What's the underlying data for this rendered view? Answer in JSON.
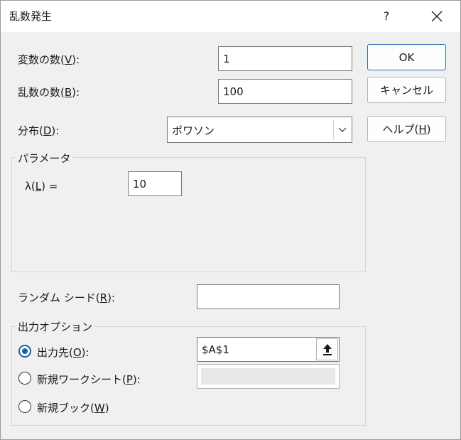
{
  "window": {
    "title": "乱数発生",
    "help_glyph": "?"
  },
  "fields": {
    "num_variables": {
      "label": "変数の数(",
      "key": "V",
      "suffix": "):",
      "value": "1"
    },
    "num_random": {
      "label": "乱数の数(",
      "key": "B",
      "suffix": "):",
      "value": "100"
    },
    "distribution": {
      "label": "分布(",
      "key": "D",
      "suffix": "):",
      "value": "ポワソン"
    },
    "seed": {
      "label": "ランダム シード(",
      "key": "R",
      "suffix": "):",
      "value": ""
    }
  },
  "buttons": {
    "ok": "OK",
    "cancel": "キャンセル",
    "help_prefix": "ヘルプ(",
    "help_key": "H",
    "help_suffix": ")"
  },
  "parameters": {
    "title": "パラメータ",
    "lambda_label": "λ(",
    "lambda_key": "L",
    "lambda_suffix": ")  =",
    "lambda_value": "10"
  },
  "output": {
    "title": "出力オプション",
    "output_range": {
      "label": "出力先(",
      "key": "O",
      "suffix": "):",
      "value": "$A$1",
      "selected": true
    },
    "new_sheet": {
      "label": "新規ワークシート(",
      "key": "P",
      "suffix": "):",
      "selected": false
    },
    "new_book": {
      "label": "新規ブック(",
      "key": "W",
      "suffix": ")",
      "selected": false
    }
  },
  "colors": {
    "accent": "#1f5fb0",
    "background": "#f0f0f0"
  }
}
